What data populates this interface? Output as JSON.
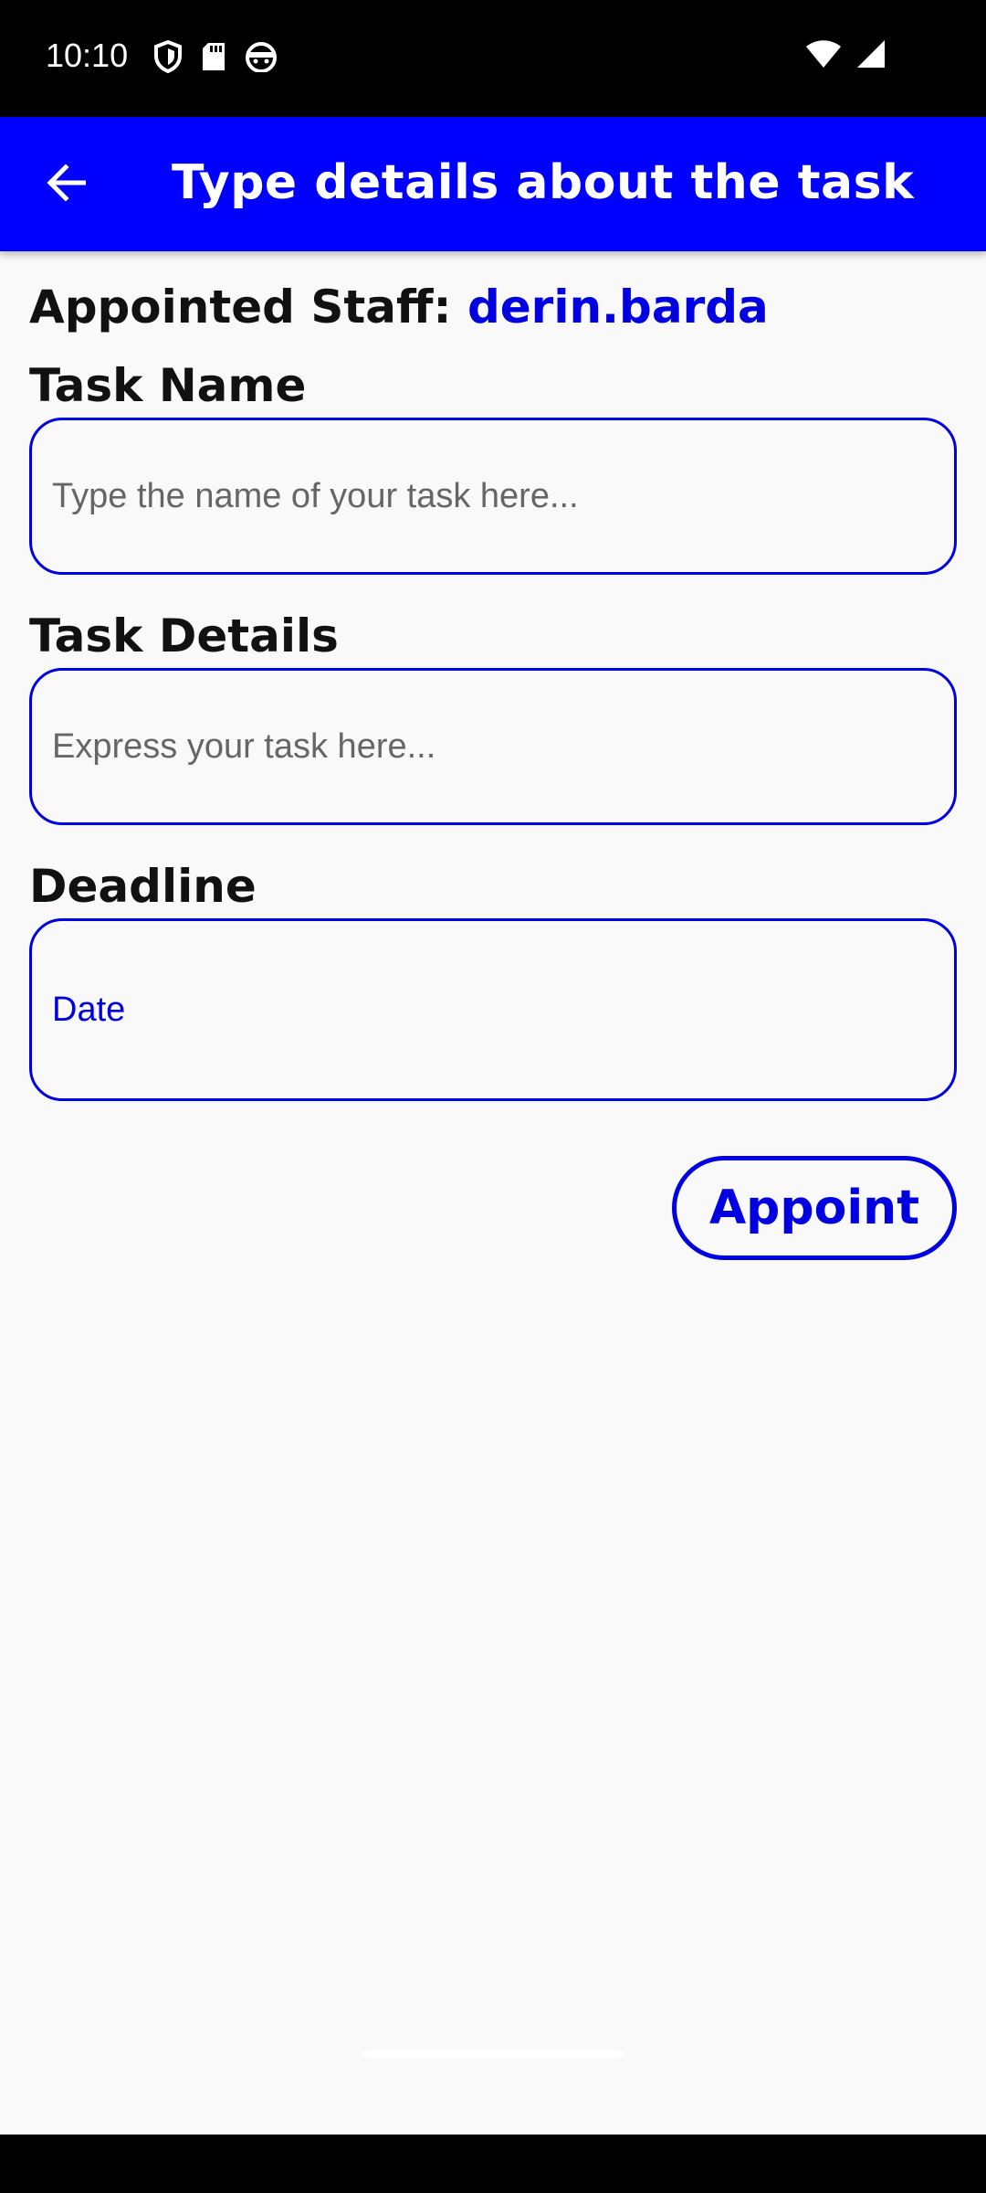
{
  "status_bar": {
    "time": "10:10",
    "left_icons": [
      "shield-icon",
      "sd-card-icon",
      "android-face-icon"
    ],
    "right_icons": [
      "wifi-icon",
      "signal-icon"
    ]
  },
  "app_bar": {
    "title": "Type details about the task",
    "back_icon": "arrow-left-icon",
    "background_color": "#0000ff"
  },
  "staff": {
    "label": "Appointed Staff:",
    "name": "derin.barda"
  },
  "task_name": {
    "label": "Task Name",
    "placeholder": "Type the name of your task here..."
  },
  "task_details": {
    "label": "Task Details",
    "placeholder": "Express your task here..."
  },
  "deadline": {
    "label": "Deadline",
    "value": "Date"
  },
  "appoint_button": {
    "label": "Appoint"
  },
  "colors": {
    "accent": "#0000e0",
    "status_bar": "#000000",
    "background": "#f9f9f9"
  }
}
